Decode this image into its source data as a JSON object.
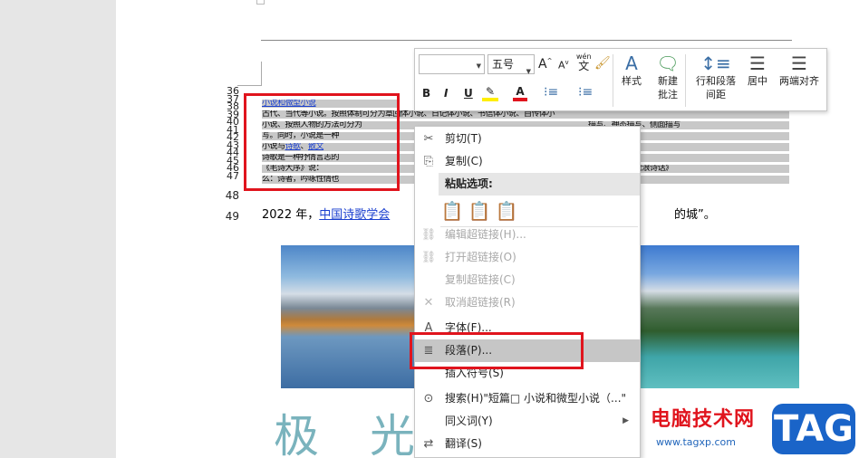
{
  "document": {
    "line_numbers": [
      "36",
      "37",
      "38",
      "39",
      "40",
      "41",
      "42",
      "43",
      "44",
      "45",
      "46",
      "47",
      "48",
      "49"
    ],
    "selected_lines": [
      {
        "pre": "",
        "link": "小说和",
        "mid": "",
        "link2": "微型小说",
        "post": "（小小说）"
      },
      {
        "pre": "古代、当代等小说。按照体制可分为章回体小说、日记体小说、书信体小说、自传体小",
        "link": "",
        "mid": "",
        "link2": "",
        "post": ""
      },
      {
        "pre": "小说、按照人物的方法可分为",
        "link": "",
        "mid": "",
        "link2": "",
        "post": "描写、神态描写、侧面描写"
      },
      {
        "pre": "写。同时，小说是一种",
        "link": "",
        "mid": "",
        "link2": "",
        "post": ""
      },
      {
        "pre": "小说与",
        "link": "诗歌",
        "mid": "、",
        "link2": "散文",
        "post": "、戏剧"
      },
      {
        "pre": "诗歌是一种抒情言志的",
        "link": "",
        "mid": "",
        "link2": "",
        "post": "的文学"
      },
      {
        "pre": "《毛诗大序》说：",
        "link": "",
        "mid": "",
        "link2": "",
        "post": "。南宋严羽《沧浪诗话》"
      },
      {
        "pre": "么：诗者，吟咏性情也",
        "link": "",
        "mid": "",
        "link2": "",
        "post": "韵。"
      }
    ],
    "para49": {
      "pre": "2022 年，",
      "link": "中国诗歌学会",
      "post": "的城”。"
    },
    "big_chars": [
      "极",
      "光"
    ]
  },
  "mini_toolbar": {
    "font_name": "",
    "font_size": "五号",
    "grow_font": "A",
    "shrink_font": "A",
    "phonetic": "wén",
    "bold": "B",
    "italic": "I",
    "underline": "U",
    "styles_label": "样式",
    "new_comment_label": [
      "新建",
      "批注"
    ],
    "line_spacing_label": [
      "行和段落",
      "间距"
    ],
    "center_label": "居中",
    "justify_label": "两端对齐"
  },
  "context_menu": {
    "items": [
      {
        "label": "剪切(T)",
        "icon": "cut-icon",
        "glyph": "✂",
        "disabled": false
      },
      {
        "label": "复制(C)",
        "icon": "copy-icon",
        "glyph": "⎘",
        "disabled": false
      }
    ],
    "paste_header": "粘贴选项:",
    "paste_options": [
      "keep-source-format",
      "merge-format",
      "text-only"
    ],
    "items2": [
      {
        "label": "编辑超链接(H)...",
        "icon": "edit-hyperlink-icon",
        "glyph": "⛓",
        "disabled": true
      },
      {
        "label": "打开超链接(O)",
        "icon": "open-hyperlink-icon",
        "glyph": "⛓",
        "disabled": true
      },
      {
        "label": "复制超链接(C)",
        "icon": "copy-hyperlink-icon",
        "glyph": "",
        "disabled": true
      },
      {
        "label": "取消超链接(R)",
        "icon": "remove-hyperlink-icon",
        "glyph": "✕",
        "disabled": true
      },
      {
        "label": "字体(F)...",
        "icon": "font-icon",
        "glyph": "A",
        "disabled": false
      },
      {
        "label": "段落(P)...",
        "icon": "paragraph-icon",
        "glyph": "≣",
        "disabled": false,
        "highlighted": true
      },
      {
        "label": "插入符号(S)",
        "icon": "insert-symbol-icon",
        "glyph": "",
        "disabled": false
      },
      {
        "label": "搜索(H)\"短篇□ 小说和微型小说（...\"",
        "icon": "search-icon",
        "glyph": "⊙",
        "disabled": false
      },
      {
        "label": "同义词(Y)",
        "icon": "synonym-icon",
        "glyph": "",
        "disabled": false,
        "submenu": true
      },
      {
        "label": "翻译(S)",
        "icon": "translate-icon",
        "glyph": "⇄",
        "disabled": false
      }
    ]
  },
  "watermark": {
    "site": "电脑技术网",
    "url": "www.tagxp.com",
    "tag": "TAG"
  },
  "colors": {
    "accent_red": "#e0141d",
    "link_blue": "#1a3fcf",
    "menu_highlight": "#c6c6c6"
  }
}
